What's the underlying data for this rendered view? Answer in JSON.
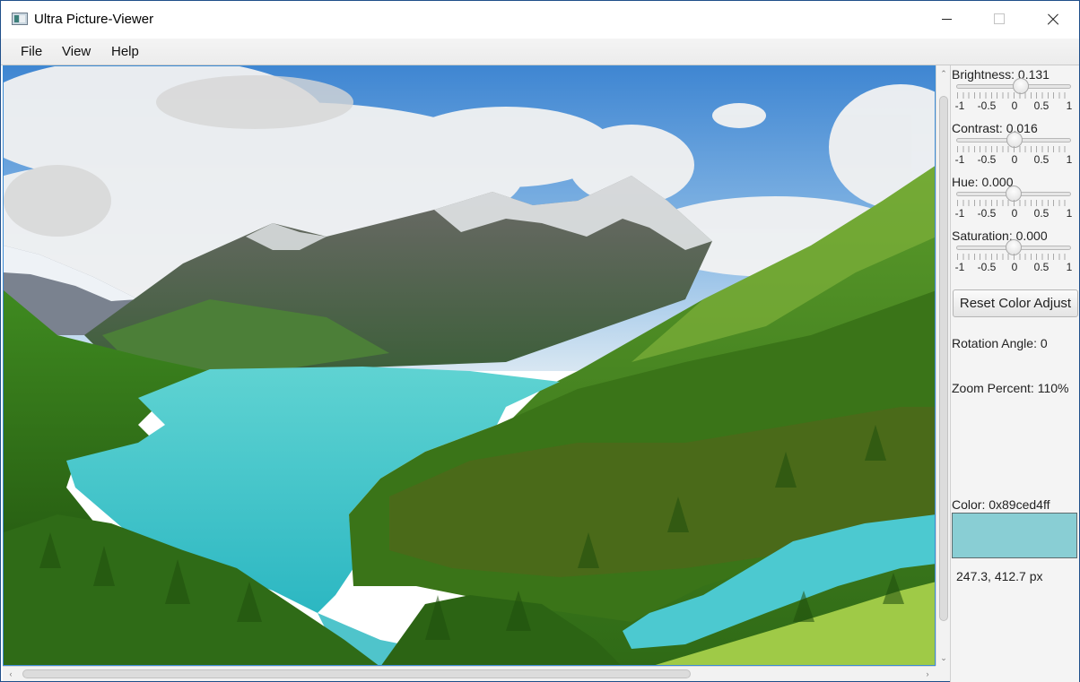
{
  "window": {
    "title": "Ultra Picture-Viewer"
  },
  "menu": {
    "items": [
      "File",
      "View",
      "Help"
    ]
  },
  "image": {
    "subject": "mountain lake landscape"
  },
  "controls": {
    "brightness": {
      "label": "Brightness: 0.131",
      "value": 0.131
    },
    "contrast": {
      "label": "Contrast: 0.016",
      "value": 0.016
    },
    "hue": {
      "label": "Hue: 0.000",
      "value": 0.0
    },
    "saturation": {
      "label": "Saturation: 0.000",
      "value": 0.0
    },
    "slider_min": -1,
    "slider_max": 1,
    "tick_labels": [
      "-1",
      "-0.5",
      "0",
      "0.5",
      "1"
    ],
    "reset_label": "Reset Color Adjust"
  },
  "info": {
    "rotation_label": "Rotation Angle: 0",
    "zoom_label": "Zoom Percent: 110%",
    "color_label": "Color: 0x89ced4ff",
    "color_hex": "#89ced4",
    "coords_label": "247.3, 412.7 px"
  }
}
